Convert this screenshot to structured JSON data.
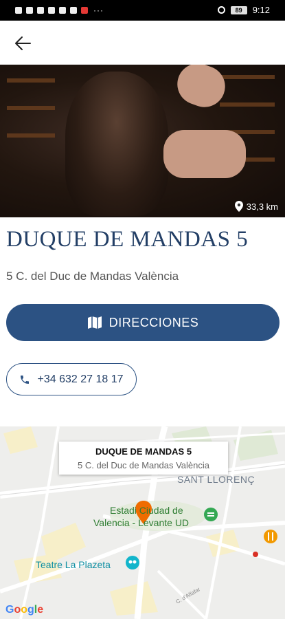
{
  "status_bar": {
    "time": "9:12",
    "battery": "89",
    "dots": "···"
  },
  "header": {
    "back_icon": "arrow-left-icon"
  },
  "hero": {
    "distance": "33,3 km"
  },
  "place": {
    "name": "DUQUE DE MANDAS 5",
    "address": "5 C. del Duc de Mandas València",
    "directions_label": "DIRECCIONES",
    "phone": "+34 632 27 18 17"
  },
  "map": {
    "info_title": "DUQUE DE MANDAS 5",
    "info_address": "5 C. del Duc de Mandas València",
    "labels": {
      "district": "SANT LLORENÇ",
      "stadium_line1": "Estadi Ciudad de",
      "stadium_line2": "Valencia - Levante UD",
      "theatre": "Teatre La Plazeta",
      "street": "C. d'Alfafar"
    },
    "attribution": {
      "g1": "G",
      "o1": "o",
      "o2": "o",
      "g2": "g",
      "l": "l",
      "e": "e"
    }
  },
  "colors": {
    "primary": "#2c5283",
    "title": "#233f66",
    "pin": "#ef6c00"
  }
}
